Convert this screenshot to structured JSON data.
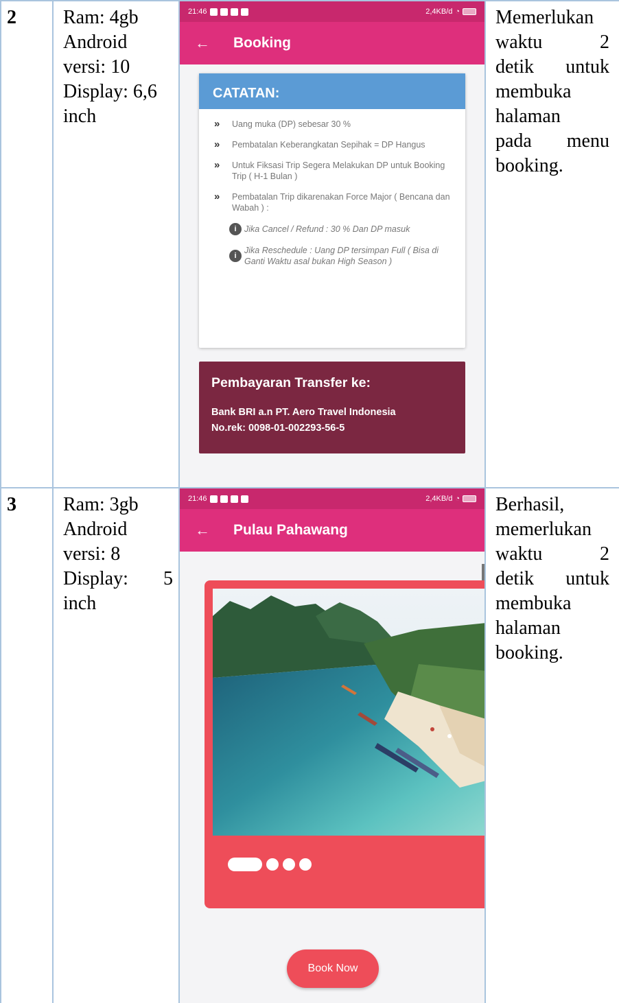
{
  "colors": {
    "table_border": "#a9c4de",
    "app_bar_pink": "#de2f7c",
    "status_bar_pink": "#c8286d",
    "note_header_blue": "#5b9bd5",
    "payment_card_maroon": "#7b2741",
    "carousel_red": "#ee4d59"
  },
  "rows": [
    {
      "number": "2",
      "specs": [
        "Ram: 4gb",
        "Android",
        "versi: 10",
        "Display: 6,6",
        "inch"
      ],
      "phone": {
        "status_time": "21:46",
        "status_right": "2,4KB/d",
        "back_icon": "arrow-back-icon",
        "title": "Booking",
        "note_title": "CATATAN:",
        "notes": [
          "Uang muka (DP) sebesar 30 %",
          "Pembatalan Keberangkatan Sepihak = DP Hangus",
          "Untuk Fiksasi Trip Segera Melakukan DP untuk Booking Trip ( H-1 Bulan )",
          "Pembatalan Trip dikarenakan Force Major ( Bencana dan Wabah ) :"
        ],
        "sub_notes": [
          "Jika Cancel / Refund : 30 % Dan DP masuk",
          "Jika Reschedule : Uang DP tersimpan Full ( Bisa di Ganti Waktu asal bukan High Season )"
        ],
        "payment_title": "Pembayaran Transfer ke:",
        "payment_bank": "Bank BRI a.n PT. Aero Travel Indonesia",
        "payment_account": "No.rek: 0098-01-002293-56-5"
      },
      "result": [
        "Memerlukan",
        "waktu",
        "2",
        "detik",
        "untuk",
        "membuka",
        "halaman",
        "pada",
        "menu",
        "booking."
      ]
    },
    {
      "number": "3",
      "specs": [
        "Ram: 3gb",
        "Android",
        "versi: 8",
        "Display:",
        "5",
        "inch"
      ],
      "phone": {
        "status_time": "21:46",
        "status_right": "2,4KB/d",
        "back_icon": "arrow-back-icon",
        "title": "Pulau Pahawang",
        "carousel_active_index": 0,
        "carousel_count": 4,
        "book_button": "Book Now"
      },
      "result": [
        "Berhasil,",
        "memerlukan",
        "waktu",
        "2",
        "detik",
        "untuk",
        "membuka",
        "halaman",
        "booking."
      ]
    }
  ]
}
